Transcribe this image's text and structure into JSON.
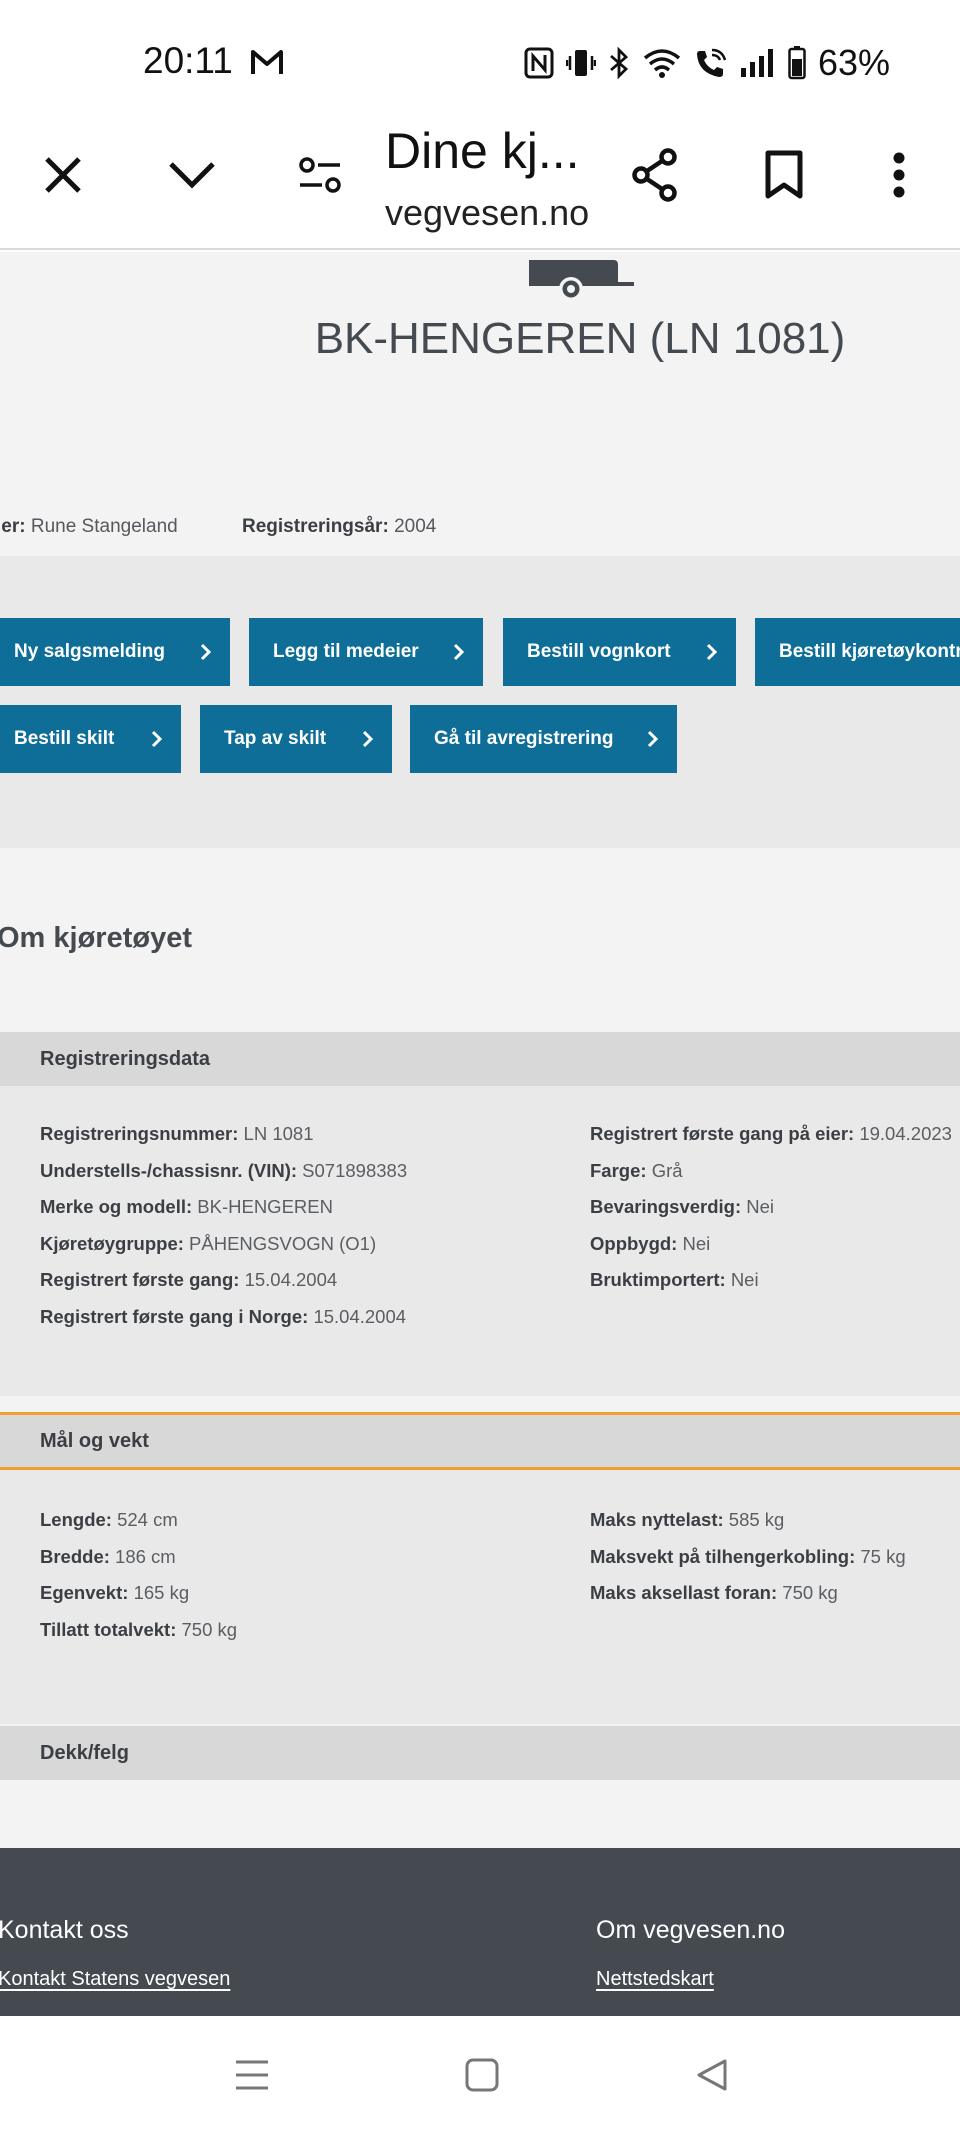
{
  "status_bar": {
    "time": "20:11",
    "battery": "63%"
  },
  "browser": {
    "title": "Dine kj...",
    "domain": "vegvesen.no"
  },
  "hero": {
    "title": "BK-HENGEREN (LN 1081)",
    "owner_label": "ier:",
    "owner_value": "Rune Stangeland",
    "year_label": "Registreringsår:",
    "year_value": "2004"
  },
  "actions": {
    "buttons": [
      "Ny salgsmelding",
      "Legg til medeier",
      "Bestill vognkort",
      "Bestill kjøretøykontro",
      "Bestill skilt",
      "Tap av skilt",
      "Gå til avregistrering"
    ]
  },
  "about": {
    "title": "Om kjøretøyet",
    "registration": {
      "header": "Registreringsdata",
      "left": [
        {
          "label": "Registreringsnummer:",
          "value": "LN 1081"
        },
        {
          "label": "Understells-/chassisnr. (VIN):",
          "value": "S071898383"
        },
        {
          "label": "Merke og modell:",
          "value": "BK-HENGEREN"
        },
        {
          "label": "Kjøretøygruppe:",
          "value": "PÅHENGSVOGN (O1)"
        },
        {
          "label": "Registrert første gang:",
          "value": "15.04.2004"
        },
        {
          "label": "Registrert første gang i Norge:",
          "value": "15.04.2004"
        }
      ],
      "right": [
        {
          "label": "Registrert første gang på eier:",
          "value": "19.04.2023"
        },
        {
          "label": "Farge:",
          "value": "Grå"
        },
        {
          "label": "Bevaringsverdig:",
          "value": "Nei"
        },
        {
          "label": "Oppbygd:",
          "value": "Nei"
        },
        {
          "label": "Bruktimportert:",
          "value": "Nei"
        }
      ]
    },
    "dimensions": {
      "header": "Mål og vekt",
      "left": [
        {
          "label": "Lengde:",
          "value": "524 cm"
        },
        {
          "label": "Bredde:",
          "value": "186 cm"
        },
        {
          "label": "Egenvekt:",
          "value": "165 kg"
        },
        {
          "label": "Tillatt totalvekt:",
          "value": "750 kg"
        }
      ],
      "right": [
        {
          "label": "Maks nyttelast:",
          "value": "585 kg"
        },
        {
          "label": "Maksvekt på tilhengerkobling:",
          "value": "75 kg"
        },
        {
          "label": "Maks aksellast foran:",
          "value": "750 kg"
        }
      ]
    },
    "tires": {
      "header": "Dekk/felg"
    }
  },
  "footer": {
    "contact_heading": "Kontakt oss",
    "contact_link": "Kontakt Statens vegvesen",
    "about_heading": "Om vegvesen.no",
    "about_link": "Nettstedskart"
  },
  "colors": {
    "primary_button": "#0e6e97",
    "footer": "#444a50",
    "active_border": "#f0a030"
  }
}
